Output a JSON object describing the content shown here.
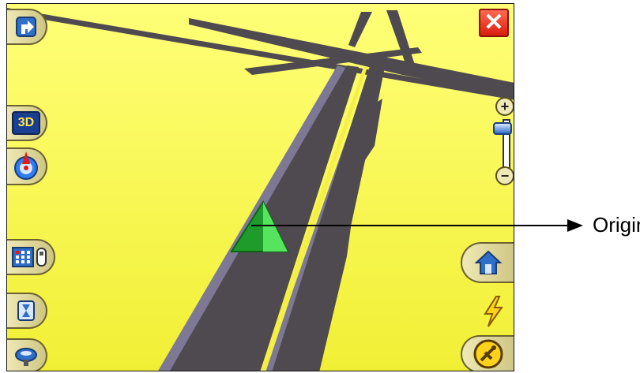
{
  "map": {
    "background": "#f7f43e",
    "road_color": "#4e4a4f",
    "road_edge_color": "#7d7894",
    "origin_marker_colors": [
      "#1e9b2b",
      "#56e35e"
    ]
  },
  "buttons": {
    "turn": {
      "icon": "turn-right-arrow-icon"
    },
    "view_3d": {
      "label": "3D"
    },
    "compass": {
      "icon": "compass-icon"
    },
    "poi": {
      "icon": "grid-poi-icon"
    },
    "route_time": {
      "icon": "hourglass-icon"
    },
    "satellite": {
      "icon": "satellite-dish-icon"
    },
    "home": {
      "icon": "home-icon"
    },
    "power": {
      "icon": "lightning-icon"
    },
    "gps": {
      "icon": "gps-antenna-icon"
    },
    "close": {
      "label": "✕"
    },
    "zoom_in": {
      "label": "+"
    },
    "zoom_out": {
      "label": "−"
    }
  },
  "annotation": {
    "label": "Origin"
  }
}
